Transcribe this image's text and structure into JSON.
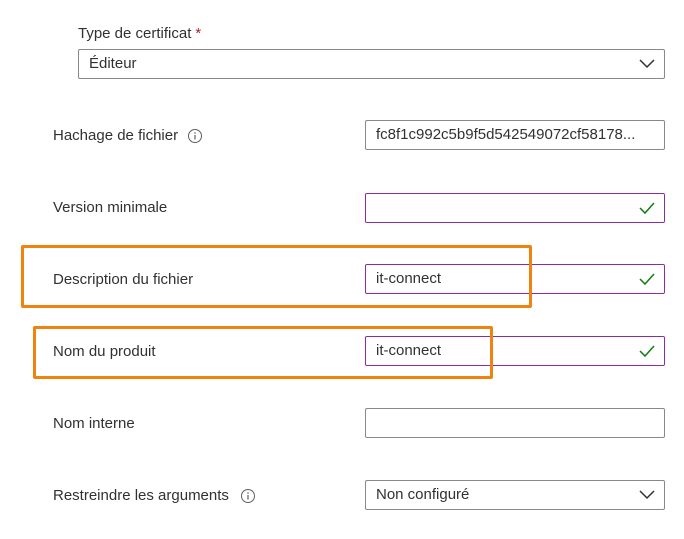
{
  "certificate_type": {
    "label": "Type de certificat",
    "required_marker": "*",
    "selected_value": "Éditeur"
  },
  "file_hash": {
    "label": "Hachage de fichier",
    "value": "fc8f1c992c5b9f5d542549072cf58178..."
  },
  "min_version": {
    "label": "Version minimale",
    "value": ""
  },
  "file_description": {
    "label": "Description du fichier",
    "value": "it-connect"
  },
  "product_name": {
    "label": "Nom du produit",
    "value": "it-connect"
  },
  "internal_name": {
    "label": "Nom interne",
    "value": ""
  },
  "restrict_args": {
    "label": "Restreindre les arguments",
    "selected_value": "Non configuré"
  },
  "colors": {
    "accent_valid_border": "#8a2da5",
    "check_green": "#107c10",
    "highlight_orange": "#f0830e",
    "required_red": "#a4262c"
  }
}
